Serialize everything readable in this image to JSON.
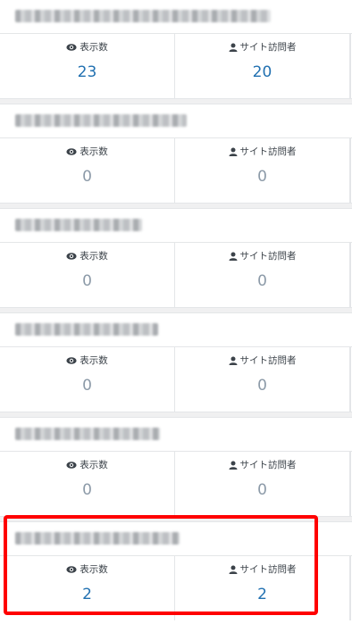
{
  "labels": {
    "views": "表示数",
    "visitors": "サイト訪問者"
  },
  "icons": {
    "views": "eye-icon",
    "visitors": "person-icon"
  },
  "colors": {
    "value_positive": "#2271b1",
    "value_zero": "#8c9aa8",
    "highlight_border": "#ff0000"
  },
  "cards": [
    {
      "title": "",
      "title_redacted": true,
      "views": "23",
      "visitors": "20"
    },
    {
      "title": "",
      "title_redacted": true,
      "views": "0",
      "visitors": "0"
    },
    {
      "title": "",
      "title_redacted": true,
      "views": "0",
      "visitors": "0"
    },
    {
      "title": "",
      "title_redacted": true,
      "views": "0",
      "visitors": "0"
    },
    {
      "title": "",
      "title_redacted": true,
      "views": "0",
      "visitors": "0"
    },
    {
      "title": "",
      "title_redacted": true,
      "views": "2",
      "visitors": "2",
      "highlighted": true
    }
  ]
}
